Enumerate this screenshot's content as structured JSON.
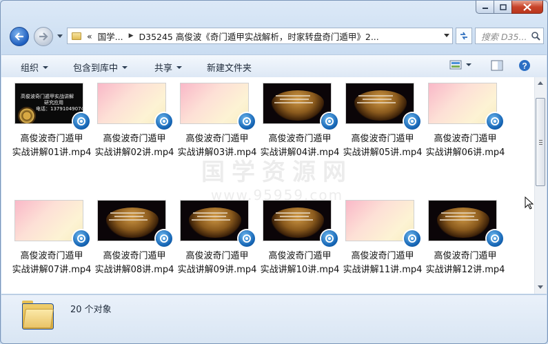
{
  "window": {
    "buttons": {
      "minimize": "minimize",
      "maximize": "maximize",
      "close": "close"
    }
  },
  "address": {
    "overflow": "«",
    "crumb1": "国学...",
    "crumb2": "D35245 高俊波《奇门遁甲实战解析，时家转盘奇门遁甲》2...",
    "refresh_icon": "refresh-icon",
    "search_placeholder": "搜索 D35..."
  },
  "toolbar": {
    "organize": "组织",
    "include_library": "包含到库中",
    "share": "共享",
    "new_folder": "新建文件夹"
  },
  "files": [
    {
      "name": "高俊波奇门遁甲实战讲解01讲.mp4",
      "thumb": "intro"
    },
    {
      "name": "高俊波奇门遁甲实战讲解02讲.mp4",
      "thumb": "pink"
    },
    {
      "name": "高俊波奇门遁甲实战讲解03讲.mp4",
      "thumb": "pink"
    },
    {
      "name": "高俊波奇门遁甲实战讲解04讲.mp4",
      "thumb": "dark"
    },
    {
      "name": "高俊波奇门遁甲实战讲解05讲.mp4",
      "thumb": "dark"
    },
    {
      "name": "高俊波奇门遁甲实战讲解06讲.mp4",
      "thumb": "pink"
    },
    {
      "name": "高俊波奇门遁甲实战讲解07讲.mp4",
      "thumb": "pink"
    },
    {
      "name": "高俊波奇门遁甲实战讲解08讲.mp4",
      "thumb": "dark"
    },
    {
      "name": "高俊波奇门遁甲实战讲解09讲.mp4",
      "thumb": "dark"
    },
    {
      "name": "高俊波奇门遁甲实战讲解10讲.mp4",
      "thumb": "dark"
    },
    {
      "name": "高俊波奇门遁甲实战讲解11讲.mp4",
      "thumb": "pink"
    },
    {
      "name": "高俊波奇门遁甲实战讲解12讲.mp4",
      "thumb": "dark"
    }
  ],
  "intro_thumb": {
    "line1": "高俊波奇门遁甲实战讲解",
    "line2": "研究应用",
    "line3": "电话：13791049074"
  },
  "watermark": {
    "main": "国学资源网",
    "url": "www.95959.com"
  },
  "status": {
    "count": "20 个对象"
  }
}
